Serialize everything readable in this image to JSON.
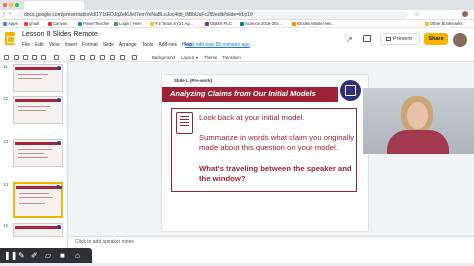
{
  "browser": {
    "url": "docs.google.com/presentation/d/1Y1tEOJqZekUlel7emYeNaBLoJoc4tdi_lfiBbUuFc2l8/edit#slide=id.p19",
    "bookmarks": [
      {
        "label": "Apps",
        "icon": "apps-icon",
        "color": "#4285f4"
      },
      {
        "label": "gmail",
        "icon": "gmail-icon",
        "color": "#ea4335"
      },
      {
        "label": "Canvas",
        "icon": "canvas-icon",
        "color": "#e53935"
      },
      {
        "label": "PowerTeacher",
        "icon": "powerteacher-icon",
        "color": "#1e88e5"
      },
      {
        "label": "Login | Here",
        "icon": "login-icon",
        "color": "#43a047"
      },
      {
        "label": "# 2 Team SY21 Ag...",
        "icon": "team-icon",
        "color": "#fbc02d"
      },
      {
        "label": "GBMS PLC",
        "icon": "plc-icon",
        "color": "#8e24aa"
      },
      {
        "label": "Science 2019-202...",
        "icon": "science-icon",
        "color": "#00897b"
      },
      {
        "label": "Brooks Master Me...",
        "icon": "brooks-icon",
        "color": "#fb8c00"
      },
      {
        "label": "Other Bookmarks",
        "icon": "folder-icon",
        "color": "#fbc02d"
      }
    ]
  },
  "docs": {
    "title": "Lesson 8 Slides Remote",
    "menu": [
      "File",
      "Edit",
      "View",
      "Insert",
      "Format",
      "Slide",
      "Arrange",
      "Tools",
      "Add-ons",
      "Help"
    ],
    "last_edit": "Last edit was 55 minutes ago",
    "present_label": "Present",
    "share_label": "Share",
    "toolbar": {
      "background": "Background",
      "layout": "Layout",
      "theme": "Theme",
      "transition": "Transition"
    }
  },
  "filmstrip": {
    "numbers": [
      "11",
      "12",
      "13",
      "14",
      "15"
    ]
  },
  "slide": {
    "label": "Slide L (Pre-work)",
    "title": "Analyzing Claims from Our Initial Models",
    "line1": "Look back at your initial model.",
    "line2": "Summarize in words what claim you originally made about this question on your model.",
    "line3": "What's traveling between the speaker and the window?"
  },
  "speaker_notes": "Click to add speaker notes",
  "colors": {
    "brand_red": "#9c2336",
    "share_yellow": "#f4b400",
    "toolbar_dark": "#2f3033"
  }
}
